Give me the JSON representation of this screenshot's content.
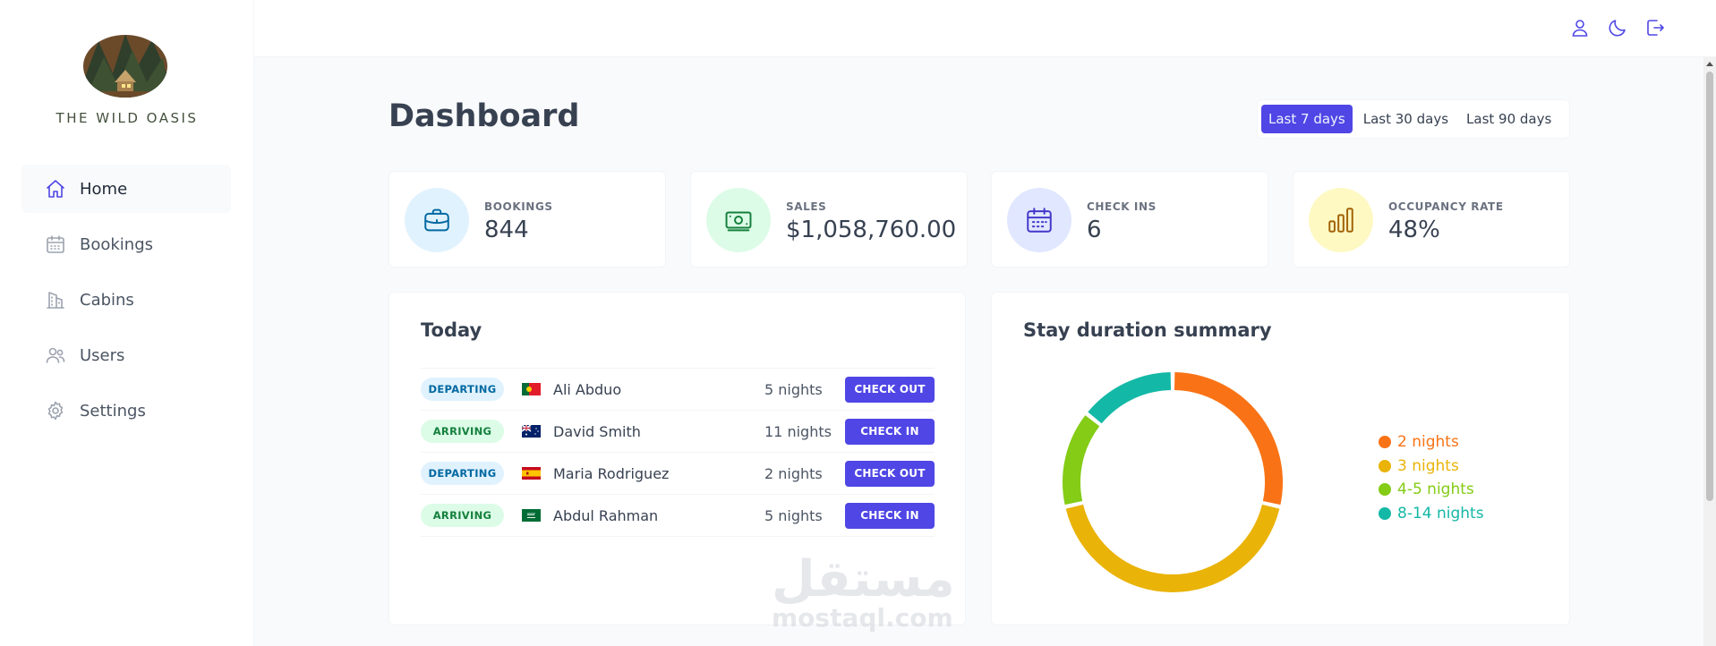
{
  "app": {
    "name": "THE WILD OASIS"
  },
  "sidebar": {
    "items": [
      {
        "label": "Home",
        "icon": "home-icon",
        "active": true
      },
      {
        "label": "Bookings",
        "icon": "calendar-icon",
        "active": false
      },
      {
        "label": "Cabins",
        "icon": "building-icon",
        "active": false
      },
      {
        "label": "Users",
        "icon": "users-icon",
        "active": false
      },
      {
        "label": "Settings",
        "icon": "gear-icon",
        "active": false
      }
    ]
  },
  "header": {
    "icons": [
      "user-icon",
      "moon-icon",
      "logout-icon"
    ]
  },
  "main": {
    "title": "Dashboard",
    "filters": [
      {
        "label": "Last 7 days",
        "active": true
      },
      {
        "label": "Last 30 days",
        "active": false
      },
      {
        "label": "Last 90 days",
        "active": false
      }
    ],
    "stats": [
      {
        "label": "BOOKINGS",
        "value": "844",
        "icon": "briefcase-icon",
        "bg": "#e0f2fe",
        "color": "#0369a1"
      },
      {
        "label": "SALES",
        "value": "$1,058,760.00",
        "icon": "banknotes-icon",
        "bg": "#dcfce7",
        "color": "#15803d"
      },
      {
        "label": "CHECK INS",
        "value": "6",
        "icon": "calendar-days-icon",
        "bg": "#e0e7ff",
        "color": "#4338ca"
      },
      {
        "label": "OCCUPANCY RATE",
        "value": "48%",
        "icon": "chart-bar-icon",
        "bg": "#fef9c3",
        "color": "#a16207"
      }
    ],
    "today": {
      "title": "Today",
      "activities": [
        {
          "status": "DEPARTING",
          "type": "departing",
          "flag": "portugal-flag",
          "guest": "Ali Abduo",
          "nights": "5 nights",
          "action": "CHECK OUT"
        },
        {
          "status": "ARRIVING",
          "type": "arriving",
          "flag": "australia-flag",
          "guest": "David Smith",
          "nights": "11 nights",
          "action": "CHECK IN"
        },
        {
          "status": "DEPARTING",
          "type": "departing",
          "flag": "spain-flag",
          "guest": "Maria Rodriguez",
          "nights": "2 nights",
          "action": "CHECK OUT"
        },
        {
          "status": "ARRIVING",
          "type": "arriving",
          "flag": "saudi-arabia-flag",
          "guest": "Abdul Rahman",
          "nights": "5 nights",
          "action": "CHECK IN"
        }
      ]
    },
    "duration": {
      "title": "Stay duration summary"
    }
  },
  "chart_data": {
    "type": "pie",
    "variant": "donut",
    "title": "Stay duration summary",
    "categories": [
      "2 nights",
      "3 nights",
      "4-5 nights",
      "8-14 nights"
    ],
    "values": [
      2,
      3,
      1,
      1
    ],
    "colors": [
      "#f97316",
      "#eab308",
      "#84cc16",
      "#14b8a6"
    ],
    "legend": "right"
  },
  "watermark": {
    "arabic": "مستقل",
    "latin": "mostaql.com"
  }
}
